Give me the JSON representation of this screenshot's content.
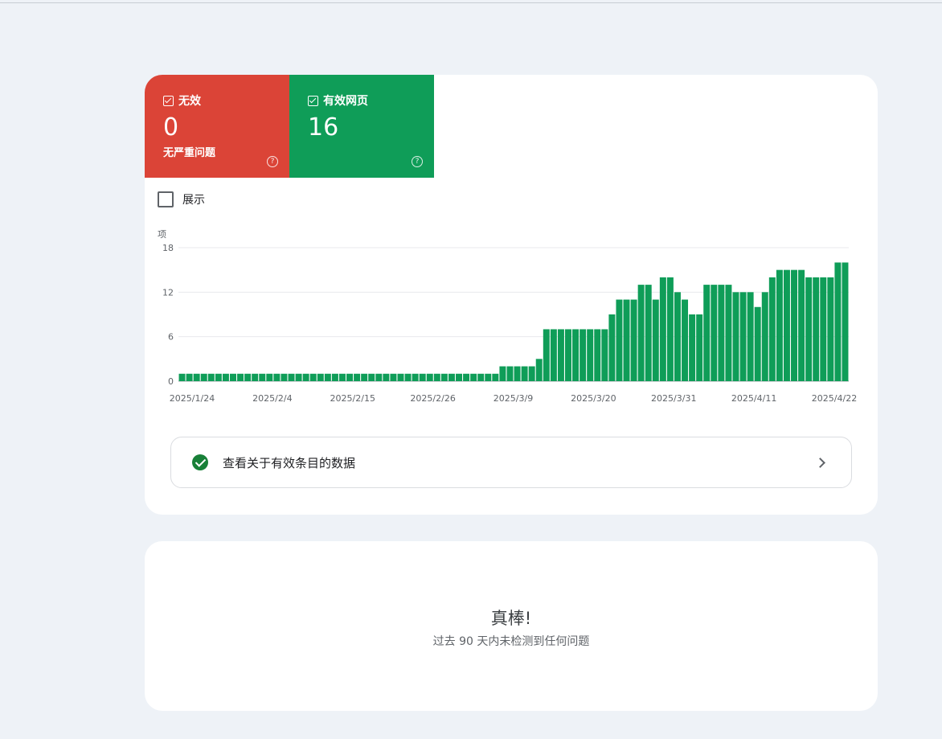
{
  "tiles": {
    "invalid": {
      "label": "无效",
      "count": "0",
      "sub": "无严重问题",
      "color": "#db4437"
    },
    "valid": {
      "label": "有效网页",
      "count": "16",
      "color": "#0f9d58"
    }
  },
  "show_label": "展示",
  "chart_data": {
    "type": "bar",
    "ylabel": "项",
    "ylim": [
      0,
      18
    ],
    "yticks": [
      "0",
      "6",
      "12",
      "18"
    ],
    "x_tick_labels": [
      "2025/1/24",
      "2025/2/4",
      "2025/2/15",
      "2025/2/26",
      "2025/3/9",
      "2025/3/20",
      "2025/3/31",
      "2025/4/11",
      "2025/4/22"
    ],
    "series": [
      {
        "color": "#0f9d58",
        "values": [
          1,
          1,
          1,
          1,
          1,
          1,
          1,
          1,
          1,
          1,
          1,
          1,
          1,
          1,
          1,
          1,
          1,
          1,
          1,
          1,
          1,
          1,
          1,
          1,
          1,
          1,
          1,
          1,
          1,
          1,
          1,
          1,
          1,
          1,
          1,
          1,
          1,
          1,
          1,
          1,
          1,
          1,
          1,
          1,
          2,
          2,
          2,
          2,
          2,
          3,
          7,
          7,
          7,
          7,
          7,
          7,
          7,
          7,
          7,
          9,
          11,
          11,
          11,
          13,
          13,
          11,
          14,
          14,
          12,
          11,
          9,
          9,
          13,
          13,
          13,
          13,
          12,
          12,
          12,
          10,
          12,
          14,
          15,
          15,
          15,
          15,
          14,
          14,
          14,
          14,
          16,
          16
        ]
      }
    ]
  },
  "link_label": "查看关于有效条目的数据",
  "ok": {
    "title": "真棒!",
    "sub": "过去 90 天内未检测到任何问题"
  }
}
